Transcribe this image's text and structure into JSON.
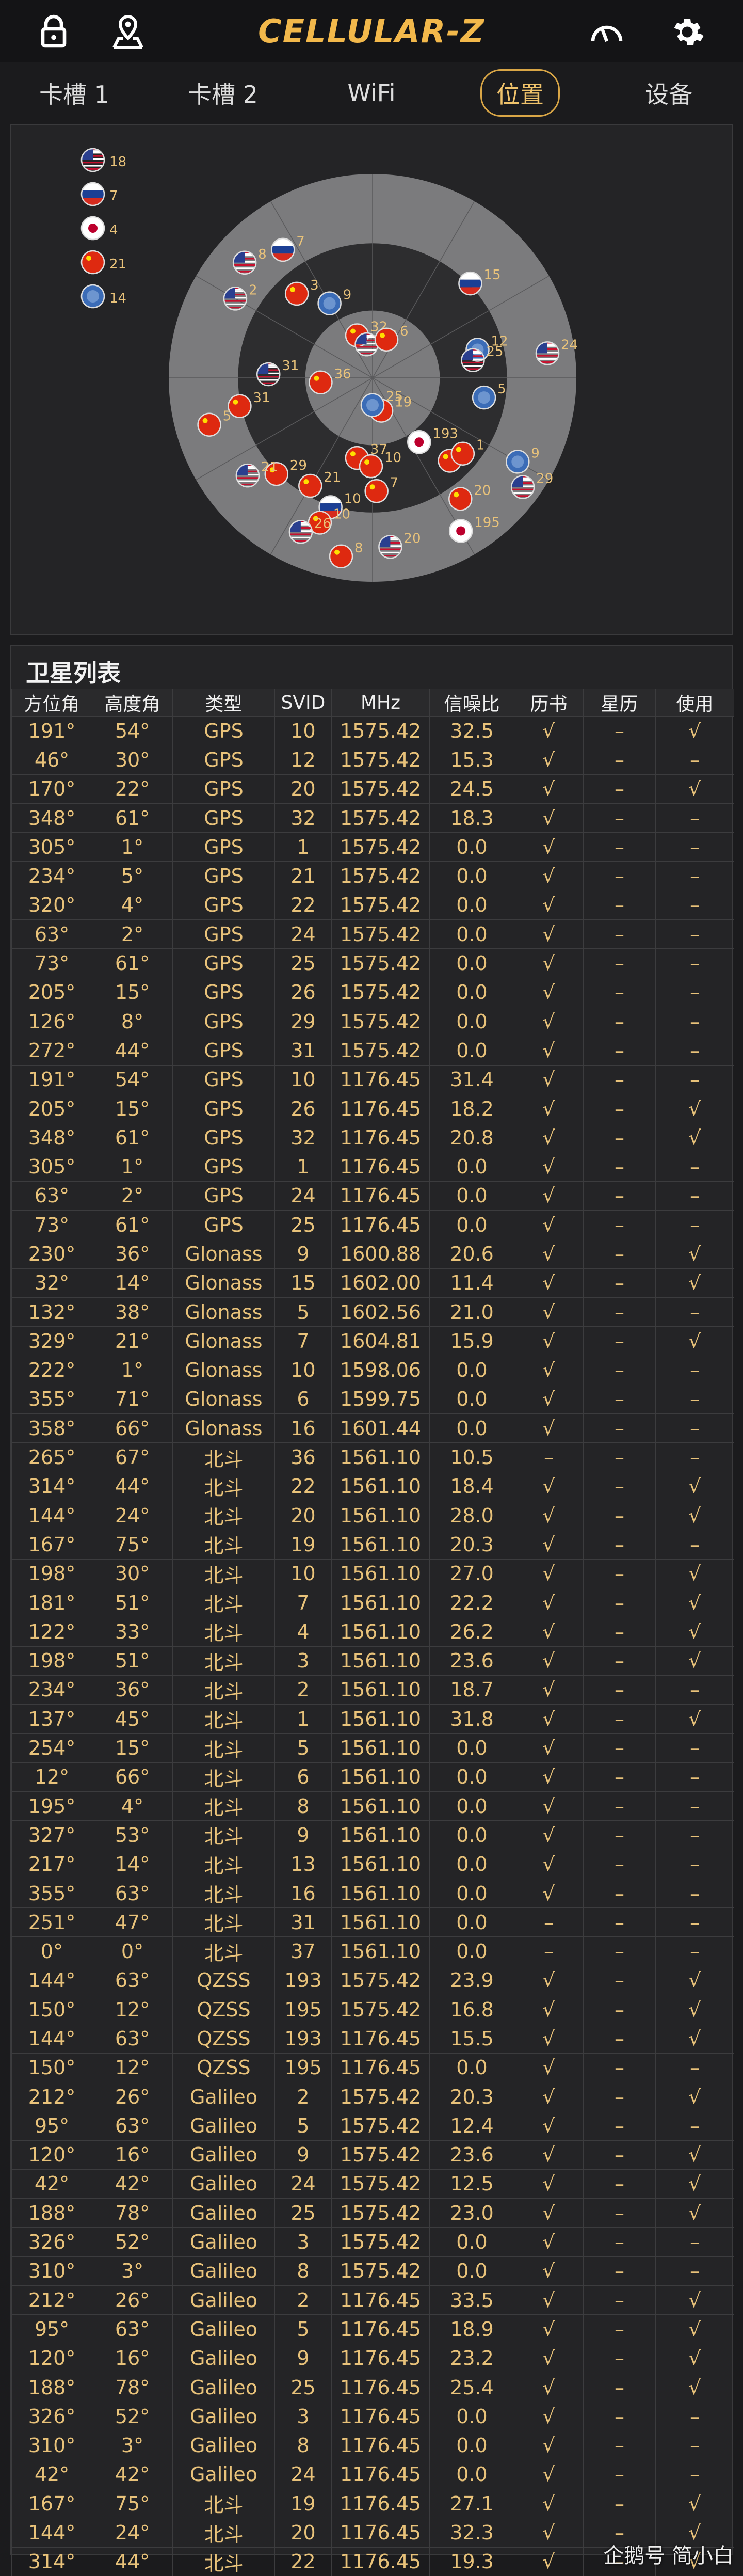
{
  "app": {
    "title": "CELLULAR-Z"
  },
  "icons": {
    "lock": "lock-icon",
    "map": "map-pin-icon",
    "speed": "speedometer-icon",
    "settings": "gear-icon"
  },
  "tabs": [
    {
      "label": "卡槽 1",
      "active": false
    },
    {
      "label": "卡槽 2",
      "active": false
    },
    {
      "label": "WiFi",
      "active": false
    },
    {
      "label": "位置",
      "active": true
    },
    {
      "label": "设备",
      "active": false
    }
  ],
  "legend": [
    {
      "flag": "us",
      "count": "18"
    },
    {
      "flag": "ru",
      "count": "7"
    },
    {
      "flag": "jp",
      "count": "4"
    },
    {
      "flag": "cn",
      "count": "21"
    },
    {
      "flag": "eu",
      "count": "14"
    }
  ],
  "sky": [
    {
      "f": "cn",
      "az": 191,
      "el": 54,
      "id": "37"
    },
    {
      "f": "ru",
      "az": 46,
      "el": 30,
      "id": "15"
    },
    {
      "f": "eu",
      "az": 75,
      "el": 42,
      "id": "12"
    },
    {
      "f": "us",
      "az": 82,
      "el": 12,
      "id": "24"
    },
    {
      "f": "us",
      "az": 80,
      "el": 45,
      "id": "25"
    },
    {
      "f": "eu",
      "az": 100,
      "el": 40,
      "id": "5"
    },
    {
      "f": "jp",
      "az": 144,
      "el": 55,
      "id": "193"
    },
    {
      "f": "jp",
      "az": 150,
      "el": 12,
      "id": "195"
    },
    {
      "f": "ru",
      "az": 325,
      "el": 21,
      "id": "7"
    },
    {
      "f": "us",
      "az": 312,
      "el": 14,
      "id": "8"
    },
    {
      "f": "us",
      "az": 300,
      "el": 20,
      "id": "2"
    },
    {
      "f": "cn",
      "az": 318,
      "el": 40,
      "id": "3"
    },
    {
      "f": "eu",
      "az": 330,
      "el": 52,
      "id": "9"
    },
    {
      "f": "cn",
      "az": 340,
      "el": 70,
      "id": "32"
    },
    {
      "f": "us",
      "az": 350,
      "el": 75,
      "id": "16"
    },
    {
      "f": "cn",
      "az": 20,
      "el": 72,
      "id": "6"
    },
    {
      "f": "us",
      "az": 272,
      "el": 44,
      "id": "31"
    },
    {
      "f": "cn",
      "az": 265,
      "el": 67,
      "id": "36"
    },
    {
      "f": "cn",
      "az": 258,
      "el": 30,
      "id": "31"
    },
    {
      "f": "cn",
      "az": 254,
      "el": 15,
      "id": "5"
    },
    {
      "f": "cn",
      "az": 165,
      "el": 75,
      "id": "19"
    },
    {
      "f": "eu",
      "az": 180,
      "el": 78,
      "id": "25"
    },
    {
      "f": "cn",
      "az": 210,
      "el": 35,
      "id": "21"
    },
    {
      "f": "cn",
      "az": 225,
      "el": 30,
      "id": "29"
    },
    {
      "f": "us",
      "az": 232,
      "el": 20,
      "id": "21"
    },
    {
      "f": "ru",
      "az": 198,
      "el": 30,
      "id": "10"
    },
    {
      "f": "cn",
      "az": 200,
      "el": 22,
      "id": "10"
    },
    {
      "f": "cn",
      "az": 181,
      "el": 51,
      "id": "10"
    },
    {
      "f": "cn",
      "az": 178,
      "el": 40,
      "id": "7"
    },
    {
      "f": "us",
      "az": 174,
      "el": 15,
      "id": "20"
    },
    {
      "f": "cn",
      "az": 137,
      "el": 40,
      "id": "4"
    },
    {
      "f": "eu",
      "az": 120,
      "el": 16,
      "id": "9"
    },
    {
      "f": "us",
      "az": 126,
      "el": 8,
      "id": "29"
    },
    {
      "f": "cn",
      "az": 144,
      "el": 24,
      "id": "20"
    },
    {
      "f": "cn",
      "az": 130,
      "el": 38,
      "id": "1"
    },
    {
      "f": "cn",
      "az": 190,
      "el": 10,
      "id": "8"
    },
    {
      "f": "us",
      "az": 205,
      "el": 15,
      "id": "26"
    }
  ],
  "list": {
    "title": "卫星列表",
    "columns": [
      "方位角",
      "高度角",
      "类型",
      "SVID",
      "MHz",
      "信噪比",
      "历书",
      "星历",
      "使用"
    ],
    "rows": [
      [
        "191°",
        "54°",
        "GPS",
        "10",
        "1575.42",
        "32.5",
        "√",
        "–",
        "√"
      ],
      [
        "46°",
        "30°",
        "GPS",
        "12",
        "1575.42",
        "15.3",
        "√",
        "–",
        "–"
      ],
      [
        "170°",
        "22°",
        "GPS",
        "20",
        "1575.42",
        "24.5",
        "√",
        "–",
        "√"
      ],
      [
        "348°",
        "61°",
        "GPS",
        "32",
        "1575.42",
        "18.3",
        "√",
        "–",
        "–"
      ],
      [
        "305°",
        "1°",
        "GPS",
        "1",
        "1575.42",
        "0.0",
        "√",
        "–",
        "–"
      ],
      [
        "234°",
        "5°",
        "GPS",
        "21",
        "1575.42",
        "0.0",
        "√",
        "–",
        "–"
      ],
      [
        "320°",
        "4°",
        "GPS",
        "22",
        "1575.42",
        "0.0",
        "√",
        "–",
        "–"
      ],
      [
        "63°",
        "2°",
        "GPS",
        "24",
        "1575.42",
        "0.0",
        "√",
        "–",
        "–"
      ],
      [
        "73°",
        "61°",
        "GPS",
        "25",
        "1575.42",
        "0.0",
        "√",
        "–",
        "–"
      ],
      [
        "205°",
        "15°",
        "GPS",
        "26",
        "1575.42",
        "0.0",
        "√",
        "–",
        "–"
      ],
      [
        "126°",
        "8°",
        "GPS",
        "29",
        "1575.42",
        "0.0",
        "√",
        "–",
        "–"
      ],
      [
        "272°",
        "44°",
        "GPS",
        "31",
        "1575.42",
        "0.0",
        "√",
        "–",
        "–"
      ],
      [
        "191°",
        "54°",
        "GPS",
        "10",
        "1176.45",
        "31.4",
        "√",
        "–",
        "–"
      ],
      [
        "205°",
        "15°",
        "GPS",
        "26",
        "1176.45",
        "18.2",
        "√",
        "–",
        "√"
      ],
      [
        "348°",
        "61°",
        "GPS",
        "32",
        "1176.45",
        "20.8",
        "√",
        "–",
        "√"
      ],
      [
        "305°",
        "1°",
        "GPS",
        "1",
        "1176.45",
        "0.0",
        "√",
        "–",
        "–"
      ],
      [
        "63°",
        "2°",
        "GPS",
        "24",
        "1176.45",
        "0.0",
        "√",
        "–",
        "–"
      ],
      [
        "73°",
        "61°",
        "GPS",
        "25",
        "1176.45",
        "0.0",
        "√",
        "–",
        "–"
      ],
      [
        "230°",
        "36°",
        "Glonass",
        "9",
        "1600.88",
        "20.6",
        "√",
        "–",
        "√"
      ],
      [
        "32°",
        "14°",
        "Glonass",
        "15",
        "1602.00",
        "11.4",
        "√",
        "–",
        "√"
      ],
      [
        "132°",
        "38°",
        "Glonass",
        "5",
        "1602.56",
        "21.0",
        "√",
        "–",
        "–"
      ],
      [
        "329°",
        "21°",
        "Glonass",
        "7",
        "1604.81",
        "15.9",
        "√",
        "–",
        "√"
      ],
      [
        "222°",
        "1°",
        "Glonass",
        "10",
        "1598.06",
        "0.0",
        "√",
        "–",
        "–"
      ],
      [
        "355°",
        "71°",
        "Glonass",
        "6",
        "1599.75",
        "0.0",
        "√",
        "–",
        "–"
      ],
      [
        "358°",
        "66°",
        "Glonass",
        "16",
        "1601.44",
        "0.0",
        "√",
        "–",
        "–"
      ],
      [
        "265°",
        "67°",
        "北斗",
        "36",
        "1561.10",
        "10.5",
        "–",
        "–",
        "–"
      ],
      [
        "314°",
        "44°",
        "北斗",
        "22",
        "1561.10",
        "18.4",
        "√",
        "–",
        "√"
      ],
      [
        "144°",
        "24°",
        "北斗",
        "20",
        "1561.10",
        "28.0",
        "√",
        "–",
        "√"
      ],
      [
        "167°",
        "75°",
        "北斗",
        "19",
        "1561.10",
        "20.3",
        "√",
        "–",
        "–"
      ],
      [
        "198°",
        "30°",
        "北斗",
        "10",
        "1561.10",
        "27.0",
        "√",
        "–",
        "√"
      ],
      [
        "181°",
        "51°",
        "北斗",
        "7",
        "1561.10",
        "22.2",
        "√",
        "–",
        "√"
      ],
      [
        "122°",
        "33°",
        "北斗",
        "4",
        "1561.10",
        "26.2",
        "√",
        "–",
        "√"
      ],
      [
        "198°",
        "51°",
        "北斗",
        "3",
        "1561.10",
        "23.6",
        "√",
        "–",
        "√"
      ],
      [
        "234°",
        "36°",
        "北斗",
        "2",
        "1561.10",
        "18.7",
        "√",
        "–",
        "–"
      ],
      [
        "137°",
        "45°",
        "北斗",
        "1",
        "1561.10",
        "31.8",
        "√",
        "–",
        "√"
      ],
      [
        "254°",
        "15°",
        "北斗",
        "5",
        "1561.10",
        "0.0",
        "√",
        "–",
        "–"
      ],
      [
        "12°",
        "66°",
        "北斗",
        "6",
        "1561.10",
        "0.0",
        "√",
        "–",
        "–"
      ],
      [
        "195°",
        "4°",
        "北斗",
        "8",
        "1561.10",
        "0.0",
        "√",
        "–",
        "–"
      ],
      [
        "327°",
        "53°",
        "北斗",
        "9",
        "1561.10",
        "0.0",
        "√",
        "–",
        "–"
      ],
      [
        "217°",
        "14°",
        "北斗",
        "13",
        "1561.10",
        "0.0",
        "√",
        "–",
        "–"
      ],
      [
        "355°",
        "63°",
        "北斗",
        "16",
        "1561.10",
        "0.0",
        "√",
        "–",
        "–"
      ],
      [
        "251°",
        "47°",
        "北斗",
        "31",
        "1561.10",
        "0.0",
        "–",
        "–",
        "–"
      ],
      [
        "0°",
        "0°",
        "北斗",
        "37",
        "1561.10",
        "0.0",
        "–",
        "–",
        "–"
      ],
      [
        "144°",
        "63°",
        "QZSS",
        "193",
        "1575.42",
        "23.9",
        "√",
        "–",
        "√"
      ],
      [
        "150°",
        "12°",
        "QZSS",
        "195",
        "1575.42",
        "16.8",
        "√",
        "–",
        "√"
      ],
      [
        "144°",
        "63°",
        "QZSS",
        "193",
        "1176.45",
        "15.5",
        "√",
        "–",
        "√"
      ],
      [
        "150°",
        "12°",
        "QZSS",
        "195",
        "1176.45",
        "0.0",
        "√",
        "–",
        "–"
      ],
      [
        "212°",
        "26°",
        "Galileo",
        "2",
        "1575.42",
        "20.3",
        "√",
        "–",
        "√"
      ],
      [
        "95°",
        "63°",
        "Galileo",
        "5",
        "1575.42",
        "12.4",
        "√",
        "–",
        "–"
      ],
      [
        "120°",
        "16°",
        "Galileo",
        "9",
        "1575.42",
        "23.6",
        "√",
        "–",
        "√"
      ],
      [
        "42°",
        "42°",
        "Galileo",
        "24",
        "1575.42",
        "12.5",
        "√",
        "–",
        "√"
      ],
      [
        "188°",
        "78°",
        "Galileo",
        "25",
        "1575.42",
        "23.0",
        "√",
        "–",
        "√"
      ],
      [
        "326°",
        "52°",
        "Galileo",
        "3",
        "1575.42",
        "0.0",
        "√",
        "–",
        "–"
      ],
      [
        "310°",
        "3°",
        "Galileo",
        "8",
        "1575.42",
        "0.0",
        "√",
        "–",
        "–"
      ],
      [
        "212°",
        "26°",
        "Galileo",
        "2",
        "1176.45",
        "33.5",
        "√",
        "–",
        "√"
      ],
      [
        "95°",
        "63°",
        "Galileo",
        "5",
        "1176.45",
        "18.9",
        "√",
        "–",
        "√"
      ],
      [
        "120°",
        "16°",
        "Galileo",
        "9",
        "1176.45",
        "23.2",
        "√",
        "–",
        "√"
      ],
      [
        "188°",
        "78°",
        "Galileo",
        "25",
        "1176.45",
        "25.4",
        "√",
        "–",
        "√"
      ],
      [
        "326°",
        "52°",
        "Galileo",
        "3",
        "1176.45",
        "0.0",
        "√",
        "–",
        "–"
      ],
      [
        "310°",
        "3°",
        "Galileo",
        "8",
        "1176.45",
        "0.0",
        "√",
        "–",
        "–"
      ],
      [
        "42°",
        "42°",
        "Galileo",
        "24",
        "1176.45",
        "0.0",
        "√",
        "–",
        "–"
      ],
      [
        "167°",
        "75°",
        "北斗",
        "19",
        "1176.45",
        "27.1",
        "√",
        "–",
        "√"
      ],
      [
        "144°",
        "24°",
        "北斗",
        "20",
        "1176.45",
        "32.3",
        "√",
        "–",
        "√"
      ],
      [
        "314°",
        "44°",
        "北斗",
        "22",
        "1176.45",
        "19.3",
        "√",
        "–",
        "√"
      ]
    ]
  },
  "watermark": "企鹅号 简小白"
}
